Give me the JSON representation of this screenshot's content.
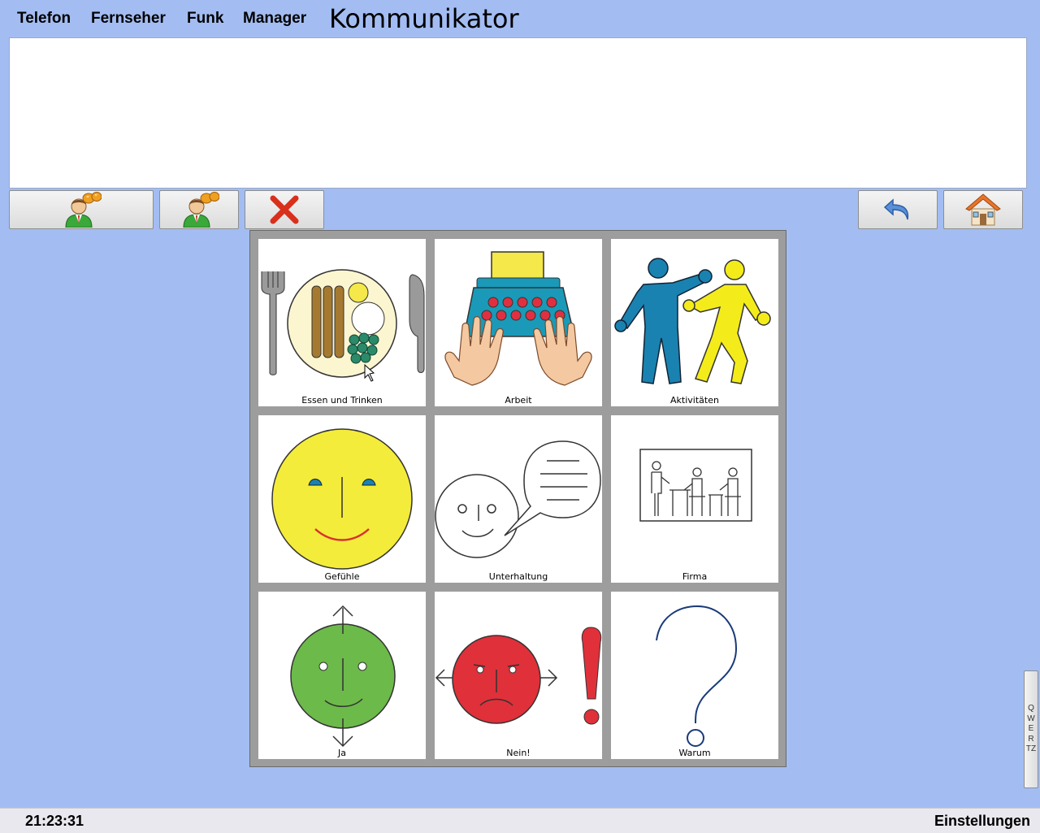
{
  "menu": {
    "items": [
      "Telefon",
      "Fernseher",
      "Funk",
      "Manager"
    ],
    "title": "Kommunikator"
  },
  "message": {
    "text": ""
  },
  "toolbar": {
    "speak_all_icon": "speaking-person-icon",
    "speak_word_icon": "speaking-person-icon",
    "clear_icon": "red-x-icon",
    "back_icon": "undo-arrow-icon",
    "home_icon": "home-icon"
  },
  "grid": {
    "cells": [
      {
        "label": "Essen und Trinken",
        "icon": "meal-plate-icon"
      },
      {
        "label": "Arbeit",
        "icon": "typewriter-icon"
      },
      {
        "label": "Aktivitäten",
        "icon": "people-activity-icon"
      },
      {
        "label": "Gefühle",
        "icon": "happy-face-icon"
      },
      {
        "label": "Unterhaltung",
        "icon": "talking-face-icon"
      },
      {
        "label": "Firma",
        "icon": "office-icon"
      },
      {
        "label": "Ja",
        "icon": "nodding-face-icon"
      },
      {
        "label": "Nein!",
        "icon": "shaking-face-icon"
      },
      {
        "label": "Warum",
        "icon": "question-mark-icon"
      }
    ]
  },
  "keyboard_tab": {
    "letters": [
      "Q",
      "W",
      "E",
      "R",
      "T",
      "Z"
    ]
  },
  "status": {
    "clock": "21:23:31",
    "settings": "Einstellungen"
  },
  "colors": {
    "background": "#a3bdf3",
    "panel": "#9d9d9d"
  }
}
